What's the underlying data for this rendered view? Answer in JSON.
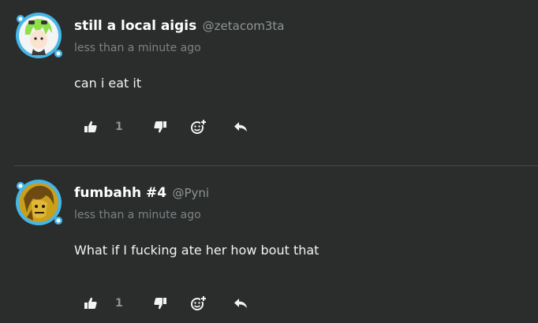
{
  "comments": [
    {
      "display_name": "still a local aigis",
      "handle": "@zetacom3ta",
      "time": "less than a minute ago",
      "text": "can i eat it",
      "like_count": "1",
      "avatar": {
        "bg": "#f4f4f4",
        "ring": "#45b6e8",
        "hair": "#8ee04a"
      }
    },
    {
      "display_name": "fumbahh #4",
      "handle": "@Pyni",
      "time": "less than a minute ago",
      "text": "What if I fucking ate her how bout that",
      "like_count": "1",
      "avatar": {
        "bg": "#c8a01c",
        "ring": "#45b6e8",
        "hair": "#6e4a12"
      }
    }
  ],
  "icons": {
    "like": "thumbs-up-icon",
    "dislike": "thumbs-down-icon",
    "react": "add-reaction-icon",
    "reply": "reply-icon"
  },
  "colors": {
    "background": "#2b2d2d",
    "divider": "#434646",
    "name": "#ffffff",
    "muted": "#8e9494"
  }
}
